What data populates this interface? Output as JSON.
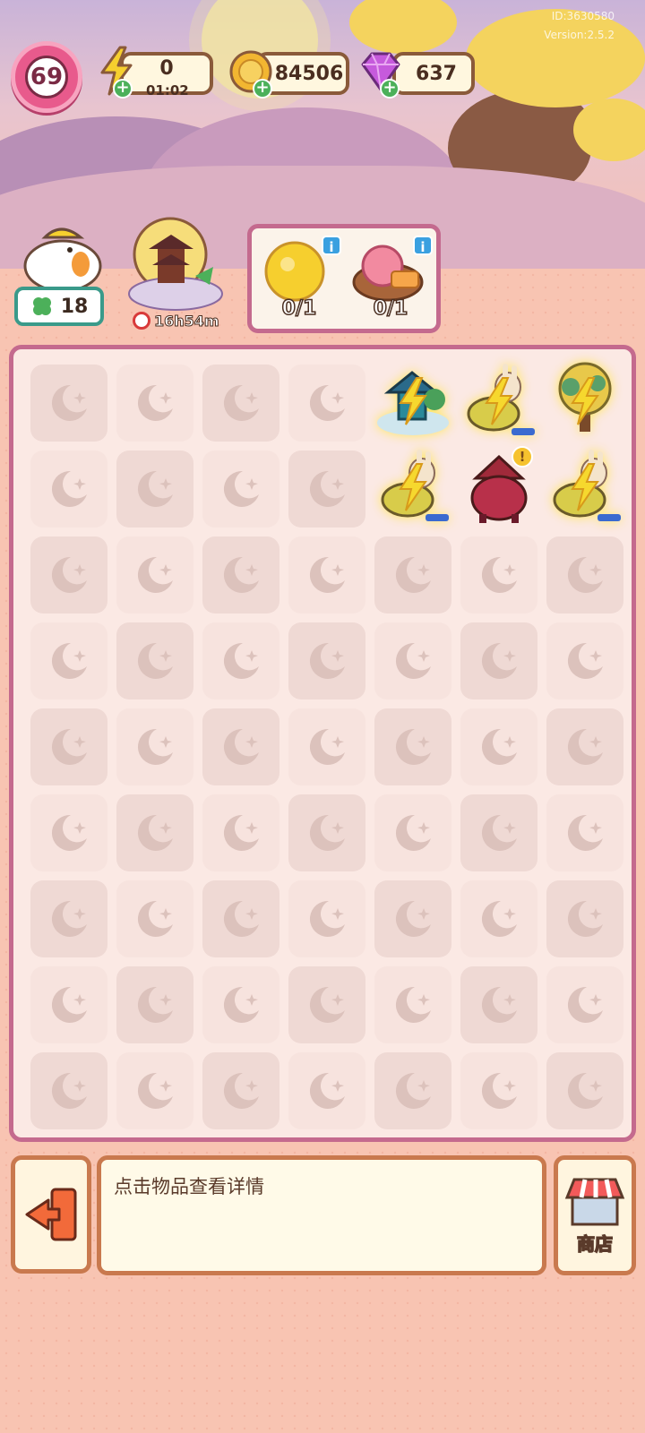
{
  "meta": {
    "id_text": "ID:3630580",
    "version_text": "Version:2.5.2"
  },
  "top_bar": {
    "level": "69",
    "energy": {
      "value": "0",
      "timer": "01:02",
      "icon": "lightning-icon"
    },
    "coins": {
      "value": "84506",
      "icon": "coin-icon"
    },
    "gems": {
      "value": "637",
      "icon": "gem-icon"
    }
  },
  "helper": {
    "clover_count": "18",
    "icon": "chicken-mascot-icon"
  },
  "event": {
    "timer": "16h54m",
    "icon": "moon-pagoda-event-icon"
  },
  "orders": [
    {
      "icon": "mooncake-yellow-icon",
      "progress": "0/1"
    },
    {
      "icon": "mooncake-pink-icon",
      "progress": "0/1"
    }
  ],
  "board": {
    "rows": 9,
    "cols": 7,
    "empty_icon": "moon-star-icon",
    "items": [
      {
        "row": 0,
        "col": 4,
        "icon": "pavilion-generator-icon",
        "energized": true
      },
      {
        "row": 0,
        "col": 5,
        "icon": "bunny-basket-icon",
        "energized": true
      },
      {
        "row": 0,
        "col": 6,
        "icon": "osmanthus-tree-icon",
        "energized": true
      },
      {
        "row": 1,
        "col": 4,
        "icon": "bunny-basket-icon",
        "energized": true
      },
      {
        "row": 1,
        "col": 5,
        "icon": "red-incense-burner-icon",
        "energized": false,
        "alert": true
      },
      {
        "row": 1,
        "col": 6,
        "icon": "bunny-basket-icon",
        "energized": true
      }
    ]
  },
  "bottom": {
    "info_text": "点击物品查看详情",
    "shop_label": "商店",
    "exit_icon": "exit-icon",
    "shop_icon": "shop-awning-icon"
  },
  "colors": {
    "frame": "#c46a8e",
    "bottom_border": "#c9794e",
    "background": "#f8c4b2"
  }
}
